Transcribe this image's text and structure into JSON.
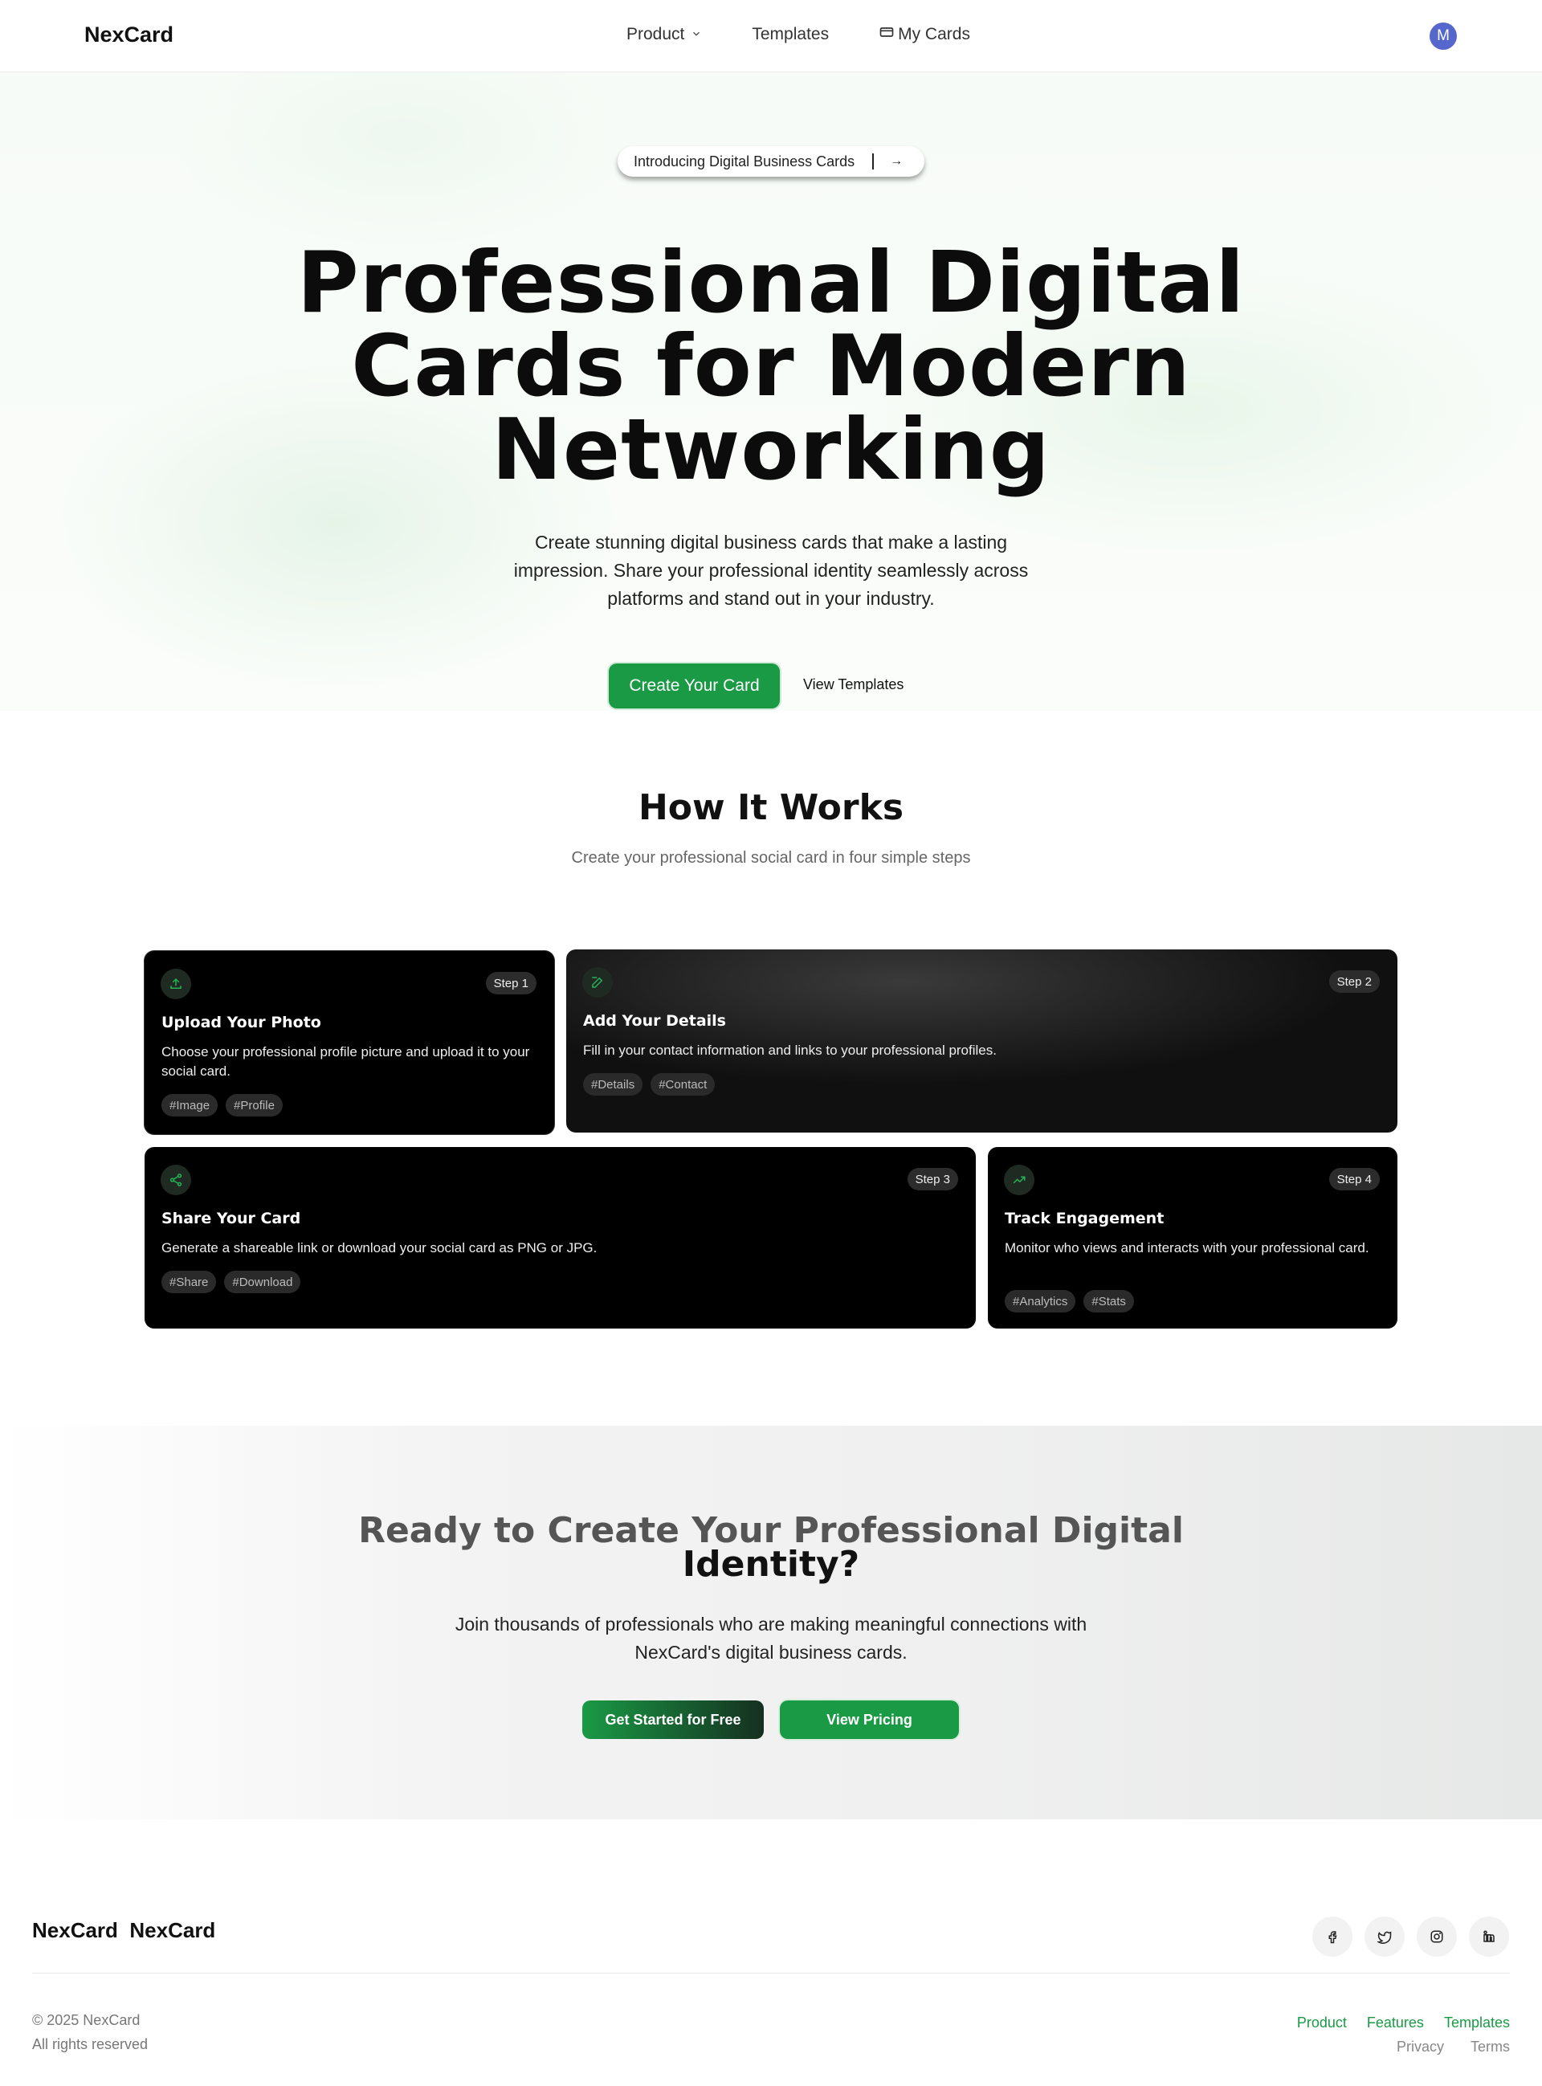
{
  "nav": {
    "brand": "NexCard",
    "links": [
      {
        "label": "Product",
        "icon": "chevron-down-icon"
      },
      {
        "label": "Templates"
      },
      {
        "label": "My Cards",
        "icon": "card-icon"
      }
    ],
    "avatar_initial": "M"
  },
  "hero": {
    "pill_text": "Introducing Digital Business Cards",
    "pill_arrow": "→",
    "title_lines": [
      "Professional Digital",
      "Cards for Modern",
      "Networking"
    ],
    "subtitle": "Create stunning digital business cards that make a lasting impression. Share your professional identity seamlessly across platforms and stand out in your industry.",
    "primary_button": "Create Your Card",
    "secondary_button": "View Templates"
  },
  "how": {
    "title": "How It Works",
    "subtitle": "Create your professional social card in four simple steps",
    "steps": [
      {
        "step": "Step 1",
        "title": "Upload Your Photo",
        "desc": "Choose your professional profile picture and upload it to your social card.",
        "tags": [
          "#Image",
          "#Profile"
        ],
        "icon": "upload-icon"
      },
      {
        "step": "Step 2",
        "title": "Add Your Details",
        "desc": "Fill in your contact information and links to your professional profiles.",
        "tags": [
          "#Details",
          "#Contact"
        ],
        "icon": "edit-icon"
      },
      {
        "step": "Step 3",
        "title": "Share Your Card",
        "desc": "Generate a shareable link or download your social card as PNG or JPG.",
        "tags": [
          "#Share",
          "#Download"
        ],
        "icon": "share-icon"
      },
      {
        "step": "Step 4",
        "title": "Track Engagement",
        "desc": "Monitor who views and interacts with your professional card.",
        "tags": [
          "#Analytics",
          "#Stats"
        ],
        "icon": "trending-up-icon"
      }
    ]
  },
  "cta": {
    "title_line1": "Ready to Create Your Professional Digital",
    "title_line2": "Identity?",
    "subtitle": "Join thousands of professionals who are making meaningful connections with NexCard's digital business cards.",
    "primary_button": "Get Started for Free",
    "secondary_button": "View Pricing"
  },
  "footer": {
    "brand": "NexCard  NexCard",
    "social_icons": [
      "facebook-icon",
      "twitter-icon",
      "instagram-icon",
      "linkedin-icon"
    ],
    "copyright": "© 2025 NexCard",
    "rights": "All rights reserved",
    "links_primary": [
      "Product",
      "Features",
      "Templates"
    ],
    "links_secondary": [
      "Privacy",
      "Terms"
    ]
  },
  "colors": {
    "accent": "#1a9a45",
    "avatar": "#5566cc",
    "card_bg": "#000000"
  }
}
